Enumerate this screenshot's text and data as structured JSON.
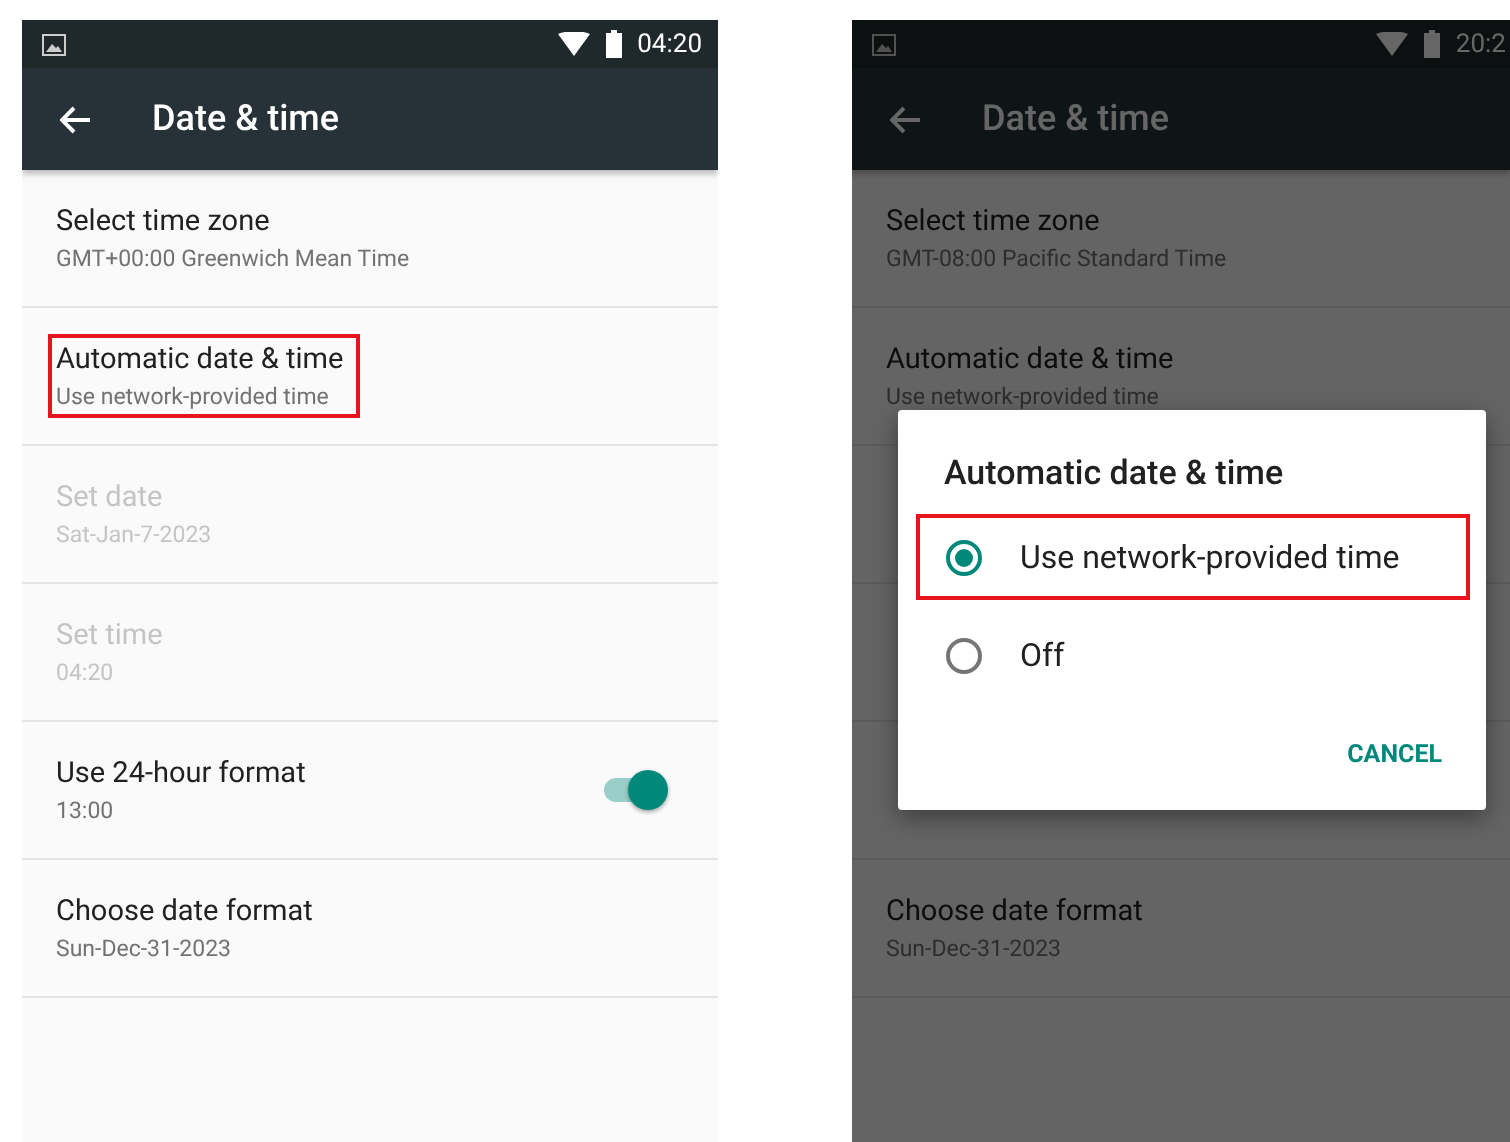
{
  "phones": [
    {
      "status": {
        "time": "04:20"
      },
      "toolbar": {
        "title": "Date & time"
      },
      "items": [
        {
          "kind": "text",
          "title": "Select time zone",
          "subtitle": "GMT+00:00 Greenwich Mean Time",
          "disabled": false,
          "highlighted": false
        },
        {
          "kind": "text",
          "title": "Automatic date & time",
          "subtitle": "Use network-provided time",
          "disabled": false,
          "highlighted": true
        },
        {
          "kind": "text",
          "title": "Set date",
          "subtitle": "Sat-Jan-7-2023",
          "disabled": true,
          "highlighted": false
        },
        {
          "kind": "text",
          "title": "Set time",
          "subtitle": "04:20",
          "disabled": true,
          "highlighted": false
        },
        {
          "kind": "switch",
          "title": "Use 24-hour format",
          "subtitle": "13:00",
          "disabled": false,
          "highlighted": false,
          "on": true
        },
        {
          "kind": "text",
          "title": "Choose date format",
          "subtitle": "Sun-Dec-31-2023",
          "disabled": false,
          "highlighted": false
        }
      ]
    },
    {
      "status": {
        "time": "20:2"
      },
      "toolbar": {
        "title": "Date & time"
      },
      "items": [
        {
          "kind": "text",
          "title": "Select time zone",
          "subtitle": "GMT-08:00 Pacific Standard Time",
          "disabled": false,
          "highlighted": false
        },
        {
          "kind": "text",
          "title": "Automatic date & time",
          "subtitle": "Use network-provided time",
          "disabled": false,
          "highlighted": false
        },
        {
          "kind": "covered"
        },
        {
          "kind": "covered"
        },
        {
          "kind": "covered"
        },
        {
          "kind": "text",
          "title": "Choose date format",
          "subtitle": "Sun-Dec-31-2023",
          "disabled": false,
          "highlighted": false
        }
      ],
      "dialog": {
        "title": "Automatic date & time",
        "options": [
          {
            "label": "Use network-provided time",
            "selected": true,
            "highlighted": true
          },
          {
            "label": "Off",
            "selected": false,
            "highlighted": false
          }
        ],
        "button": "CANCEL"
      }
    }
  ]
}
